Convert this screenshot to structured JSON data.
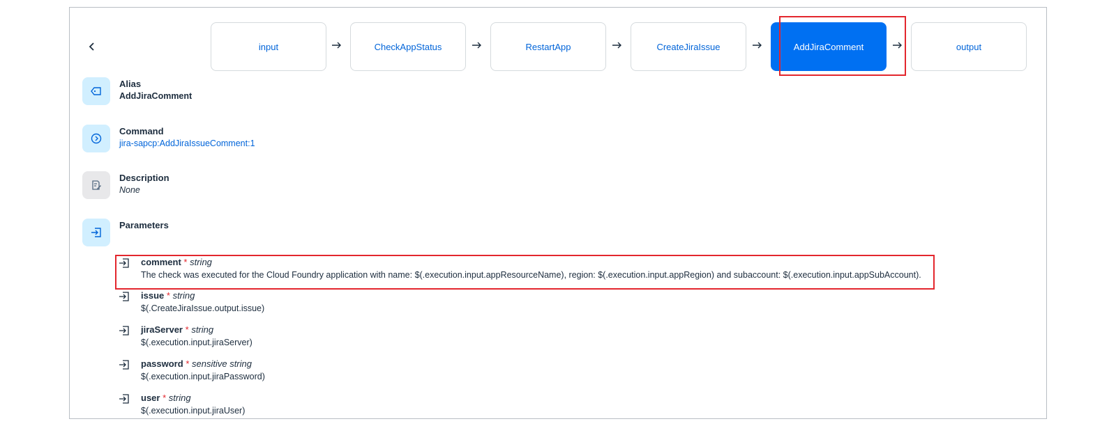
{
  "pipeline": {
    "back_icon": "chevron-left-icon",
    "arrow_icon": "arrow-right-icon",
    "steps": [
      {
        "label": "input"
      },
      {
        "label": "CheckAppStatus"
      },
      {
        "label": "RestartApp"
      },
      {
        "label": "CreateJiraIssue"
      },
      {
        "label": "AddJiraComment",
        "active": true
      },
      {
        "label": "output"
      }
    ]
  },
  "details": {
    "alias": {
      "title": "Alias",
      "value": "AddJiraComment",
      "icon": "tag-icon"
    },
    "command": {
      "title": "Command",
      "value": "jira-sapcp:AddJiraIssueComment:1",
      "icon": "navigation-right-icon"
    },
    "description": {
      "title": "Description",
      "value": "None",
      "icon": "edit-document-icon"
    },
    "parameters": {
      "title": "Parameters",
      "icon": "sign-in-icon"
    }
  },
  "params": [
    {
      "name": "comment",
      "required": "*",
      "type": "string",
      "value": "The check was executed for the Cloud Foundry application with name: $(.execution.input.appResourceName), region: $(.execution.input.appRegion) and subaccount: $(.execution.input.appSubAccount)."
    },
    {
      "name": "issue",
      "required": "*",
      "type": "string",
      "value": "$(.CreateJiraIssue.output.issue)"
    },
    {
      "name": "jiraServer",
      "required": "*",
      "type": "string",
      "value": "$(.execution.input.jiraServer)"
    },
    {
      "name": "password",
      "required": "*",
      "type": "sensitive string",
      "value": "$(.execution.input.jiraPassword)"
    },
    {
      "name": "user",
      "required": "*",
      "type": "string",
      "value": "$(.execution.input.jiraUser)"
    }
  ],
  "colors": {
    "accent": "#0070f2",
    "link": "#0064d9",
    "highlight": "#e3262d",
    "icon_bg": "#d1efff"
  }
}
